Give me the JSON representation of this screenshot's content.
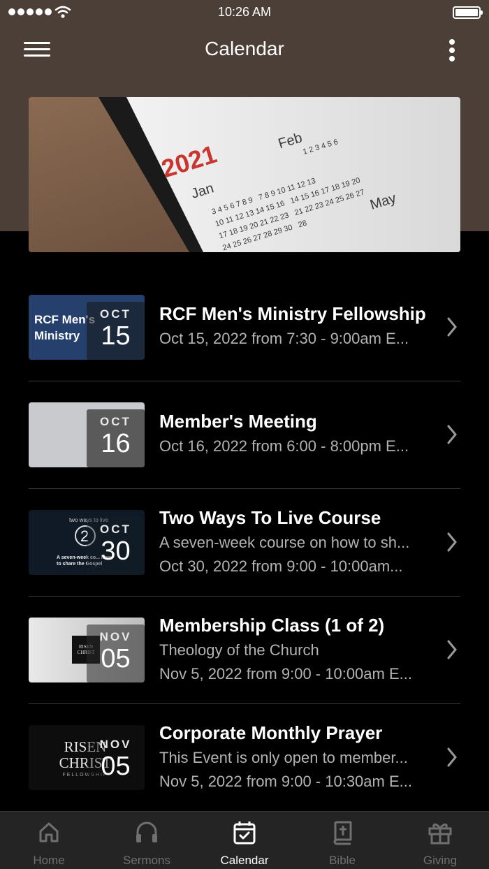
{
  "status_bar": {
    "time": "10:26 AM"
  },
  "nav": {
    "title": "Calendar"
  },
  "hero": {
    "year": "2021",
    "months": [
      "Jan",
      "Feb",
      "May"
    ]
  },
  "events": [
    {
      "month": "OCT",
      "day": "15",
      "title": "RCF Men's Ministry Fellowship",
      "lines": [
        "Oct 15, 2022 from 7:30 - 9:00am E..."
      ],
      "thumb_text": "RCF Men's Ministry"
    },
    {
      "month": "OCT",
      "day": "16",
      "title": "Member's Meeting",
      "lines": [
        "Oct 16, 2022 from 6:00 - 8:00pm E..."
      ]
    },
    {
      "month": "OCT",
      "day": "30",
      "title": "Two Ways To Live Course",
      "lines": [
        "A seven-week course on how to sh...",
        "Oct 30, 2022 from 9:00 - 10:00am..."
      ],
      "thumb_text_top": "two ways to live",
      "thumb_text_bottom": "A seven-week co... how to share the Gospel"
    },
    {
      "month": "NOV",
      "day": "05",
      "title": "Membership Class (1 of 2)",
      "lines": [
        "Theology of the Church",
        "Nov 5, 2022 from 9:00 - 10:00am E..."
      ],
      "thumb_text": "RISEN CHRIST"
    },
    {
      "month": "NOV",
      "day": "05",
      "title": "Corporate Monthly Prayer",
      "lines": [
        "This Event is only open to member...",
        "Nov 5, 2022 from 9:00 - 10:30am E..."
      ],
      "thumb_text": "RISEN CHRIST",
      "thumb_text_small": "FELLOWSHIP"
    }
  ],
  "tabs": [
    {
      "label": "Home",
      "icon": "home-icon"
    },
    {
      "label": "Sermons",
      "icon": "headphones-icon"
    },
    {
      "label": "Calendar",
      "icon": "calendar-icon",
      "active": true
    },
    {
      "label": "Bible",
      "icon": "bible-icon"
    },
    {
      "label": "Giving",
      "icon": "gift-icon"
    }
  ],
  "colors": {
    "header_bg": "#4b3f37",
    "page_bg": "#000000",
    "tab_bar_bg": "#242424",
    "inactive_tab": "#6f6f6f",
    "subtitle": "#b3b3b3"
  }
}
